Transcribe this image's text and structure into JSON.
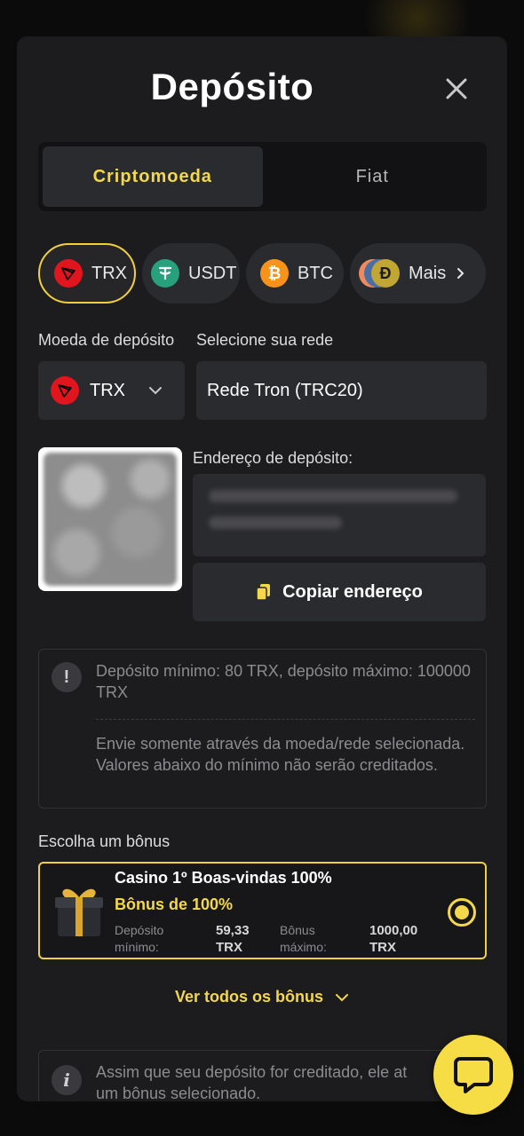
{
  "modal": {
    "title": "Depósito",
    "tabs": [
      {
        "label": "Criptomoeda",
        "active": true
      },
      {
        "label": "Fiat",
        "active": false
      }
    ]
  },
  "coins": [
    {
      "label": "TRX",
      "active": true,
      "icon": "trx-icon",
      "color": "#e0151e"
    },
    {
      "label": "USDT",
      "active": false,
      "icon": "usdt-icon",
      "color": "#26a17b"
    },
    {
      "label": "BTC",
      "active": false,
      "icon": "btc-icon",
      "color": "#f7931a"
    },
    {
      "label": "Mais",
      "active": false,
      "icon": "more-coins-icon"
    }
  ],
  "deposit": {
    "currency_label": "Moeda de depósito",
    "currency_value": "TRX",
    "network_label": "Selecione sua rede",
    "network_value": "Rede Tron (TRC20)",
    "address_label": "Endereço de depósito:",
    "copy_label": "Copiar endereço"
  },
  "notice": {
    "limits": "Depósito mínimo: 80 TRX, depósito máximo: 100000 TRX",
    "warning": "Envie somente através da moeda/rede selecionada. Valores abaixo do mínimo não serão creditados."
  },
  "bonus": {
    "section_label": "Escolha um bônus",
    "card_title": "Casino 1º Boas-vindas 100%",
    "card_subtitle": "Bônus de 100%",
    "min_deposit_label": "Depósito mínimo:",
    "min_deposit_value": "59,33 TRX",
    "max_bonus_label": "Bônus máximo:",
    "max_bonus_value": "1000,00 TRX",
    "see_all": "Ver todos os bônus"
  },
  "footer_notice": "Assim que seu depósito for creditado, ele at... um bônus selecionado.",
  "footer_notice_line1": "Assim que seu depósito for creditado, ele at",
  "footer_notice_line2": "um bônus selecionado.",
  "colors": {
    "accent": "#f5d84a",
    "panel": "#1c1c1e",
    "field": "#2a2b2e"
  }
}
